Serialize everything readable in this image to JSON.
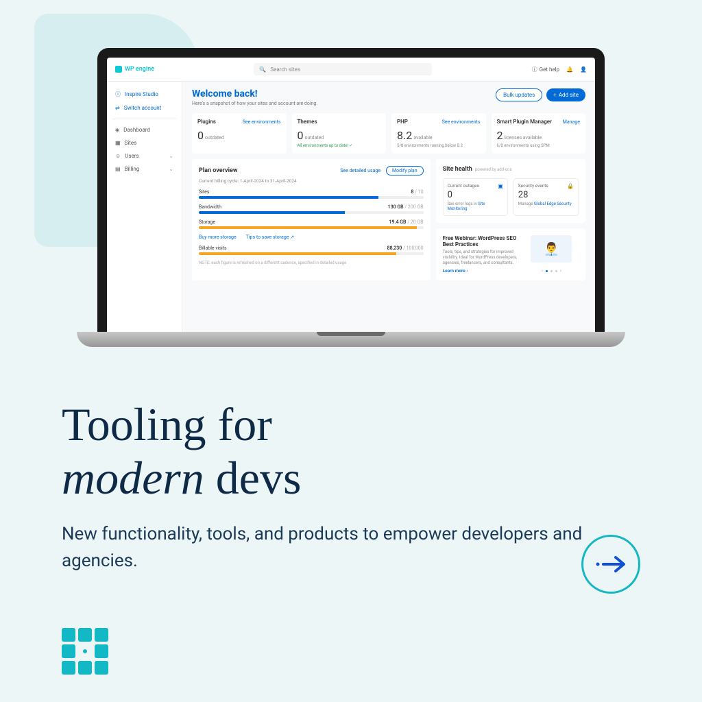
{
  "header": {
    "logo_text": "WP engine",
    "search_placeholder": "Search sites",
    "get_help": "Get help"
  },
  "sidebar": {
    "account": "Inspire Studio",
    "switch": "Switch account",
    "items": [
      "Dashboard",
      "Sites",
      "Users",
      "Billing"
    ]
  },
  "welcome": {
    "title": "Welcome back!",
    "subtitle": "Here's a snapshot of how your sites and account are doing.",
    "bulk": "Bulk updates",
    "add": "Add site"
  },
  "stats": {
    "plugins": {
      "label": "Plugins",
      "link": "See environments",
      "value": "0",
      "unit": "outdated"
    },
    "themes": {
      "label": "Themes",
      "value": "0",
      "unit": "outdated",
      "note": "All environments up to date! ✓"
    },
    "php": {
      "label": "PHP",
      "link": "See environments",
      "value": "8.2",
      "unit": "available",
      "note": "5/8 environments running below 8.2"
    },
    "spm": {
      "label": "Smart Plugin Manager",
      "link": "Manage",
      "value": "2",
      "unit": "licenses available",
      "note": "6/8 environments using SPM"
    }
  },
  "plan": {
    "title": "Plan overview",
    "detailed": "See detailed usage",
    "modify": "Modify plan",
    "cycle_label": "Current billing cycle:",
    "cycle_value": "1-April-2024 to 31-April-2024",
    "sites": {
      "label": "Sites",
      "value": "8",
      "max": "/ 10",
      "pct": 80
    },
    "bandwidth": {
      "label": "Bandwidth",
      "value": "130 GB",
      "max": "/ 200 GB",
      "pct": 65
    },
    "storage": {
      "label": "Storage",
      "value": "19.4 GB",
      "max": "/ 20 GB",
      "pct": 97
    },
    "buy": "Buy more storage",
    "tips": "Tips to save storage",
    "visits": {
      "label": "Billable visits",
      "value": "88,230",
      "max": "/ 100,000",
      "pct": 88
    },
    "note": "NOTE: each figure is refreshed on a different cadence, specified in detailed usage"
  },
  "health": {
    "title": "Site health",
    "subtitle": "powered by add-ons",
    "outages": {
      "label": "Current outages",
      "value": "0",
      "link_pre": "See error logs in ",
      "link": "Site Monitoring"
    },
    "security": {
      "label": "Security events",
      "value": "28",
      "link_pre": "Manage ",
      "link": "Global Edge Security"
    }
  },
  "webinar": {
    "title": "Free Webinar: WordPress SEO Best Practices",
    "desc": "Tools, tips, and strategies for improved visibility. Ideal for WordPress developers, agencies, freelancers, and consultants.",
    "link": "Learn more ›"
  },
  "hero": {
    "line1": "Tooling for",
    "line2_em": "modern",
    "line2_rest": " devs",
    "subtitle": "New functionality, tools, and products to empower developers and agencies."
  }
}
